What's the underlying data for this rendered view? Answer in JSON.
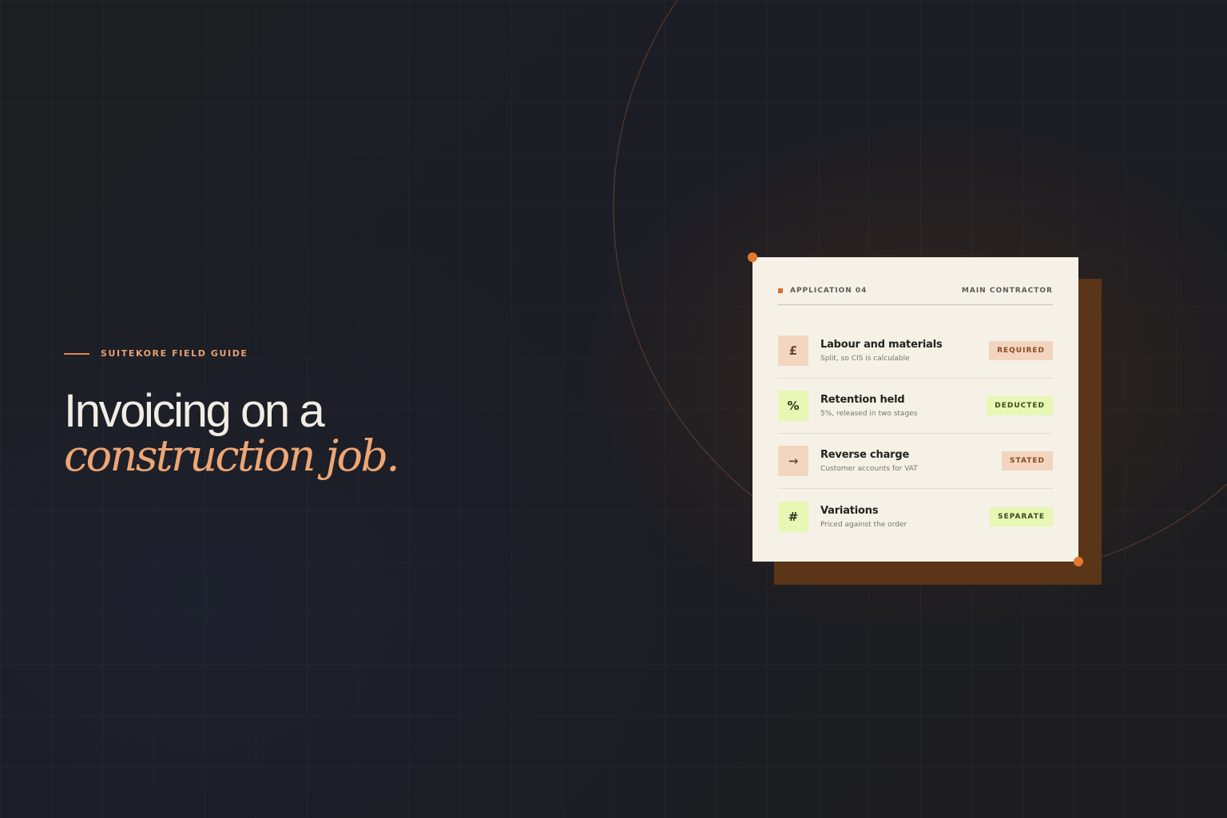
{
  "kicker": "SUITEKORE FIELD GUIDE",
  "headline": {
    "line1": "Invoicing on a",
    "line2": "construction job."
  },
  "card": {
    "label": "APPLICATION 04",
    "context": "MAIN CONTRACTOR",
    "items": [
      {
        "icon": "£",
        "icon_name": "pound-icon",
        "title": "Labour and materials",
        "subtitle": "Split, so CIS is calculable",
        "badge": "REQUIRED",
        "tone": "peach"
      },
      {
        "icon": "%",
        "icon_name": "percent-icon",
        "title": "Retention held",
        "subtitle": "5%, released in two stages",
        "badge": "DEDUCTED",
        "tone": "lime"
      },
      {
        "icon": "→",
        "icon_name": "arrow-right-icon",
        "title": "Reverse charge",
        "subtitle": "Customer accounts for VAT",
        "badge": "STATED",
        "tone": "peach"
      },
      {
        "icon": "#",
        "icon_name": "hash-icon",
        "title": "Variations",
        "subtitle": "Priced against the order",
        "badge": "SEPARATE",
        "tone": "lime"
      }
    ]
  },
  "colors": {
    "accent": "#e5772e",
    "peach": "#f3d6bf",
    "lime": "#e7f7b4",
    "card_bg": "#f5f1e6",
    "shadow": "#5a3518"
  }
}
